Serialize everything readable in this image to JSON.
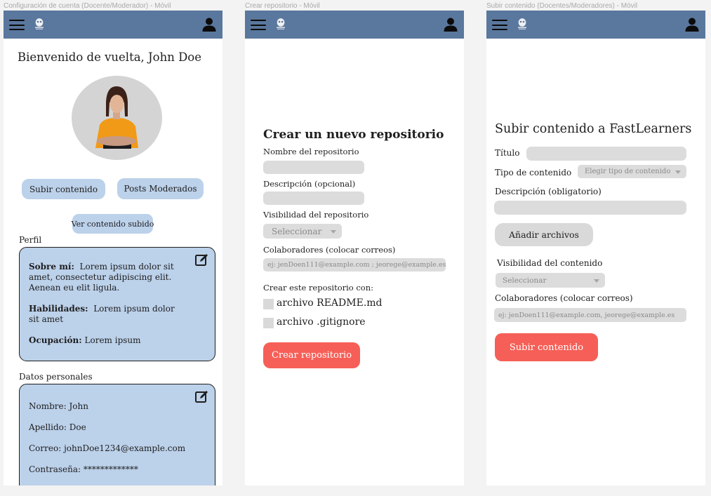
{
  "frames": {
    "account": {
      "caption": "Configuración de cuenta (Docente/Moderador) - Móvil",
      "welcome": "Bienvenido de vuelta, John Doe",
      "upload_btn": "Subir contenido",
      "moderated_btn": "Posts Moderados",
      "view_uploaded_btn": "Ver contenido subido",
      "profile": {
        "heading": "Perfil",
        "about_label": "Sobre mí:",
        "about_text": "Lorem ipsum dolor sit amet, consectetur adipiscing elit. Aenean eu elit  ligula.",
        "skills_label": "Habilidades:",
        "skills_text": "Lorem ipsum dolor sit amet",
        "occupation_label": "Ocupación:",
        "occupation_text": "Lorem ipsum"
      },
      "personal": {
        "heading": "Datos personales",
        "name_label": "Nombre:",
        "name_value": "John",
        "lastname_label": "Apellido:",
        "lastname_value": "Doe",
        "email_label": "Correo:",
        "email_value": "johnDoe1234@example.com",
        "password_label": "Contraseña:",
        "password_value": "*************"
      }
    },
    "create_repo": {
      "caption": "Crear repositorio - Móvil",
      "title": "Crear un nuevo repositorio",
      "name_label": "Nombre del repositorio",
      "desc_label": "Descripción (opcional)",
      "visibility_label": "Visibilidad del repositorio",
      "visibility_select": "Seleccionar",
      "collab_label": "Colaboradores (colocar correos)",
      "collab_placeholder": "ej: jenDoen111@example.com ; jeorege@example.es",
      "create_with_label": "Crear este repositorio con:",
      "readme_option": "archivo README.md",
      "gitignore_option": "archivo .gitignore",
      "submit": "Crear repositorio"
    },
    "upload": {
      "caption": "Subir contenido (Docentes/Moderadores) - Móvil",
      "title": "Subir contenido a FastLearners",
      "title_label": "Título",
      "type_label": "Tipo de contenido",
      "type_select": "Elegir tipo de contenido",
      "desc_label": "Descripción (obligatorio)",
      "add_files_btn": "Añadir archivos",
      "visibility_label": "Visibilidad del contenido",
      "visibility_select": "Seleccionar",
      "collab_label": "Colaboradores (colocar correos)",
      "collab_placeholder": "ej: jenDoen111@example.com, jeorege@example.es",
      "submit": "Subir contenido"
    }
  },
  "icons": {
    "menu": "hamburger-menu-icon",
    "logo": "owl-logo",
    "user": "user-icon",
    "edit": "edit-icon"
  },
  "colors": {
    "topbar": "#5a779d",
    "card": "#bcd1ea",
    "primary": "#f65f57",
    "field": "#dcdcdc"
  }
}
